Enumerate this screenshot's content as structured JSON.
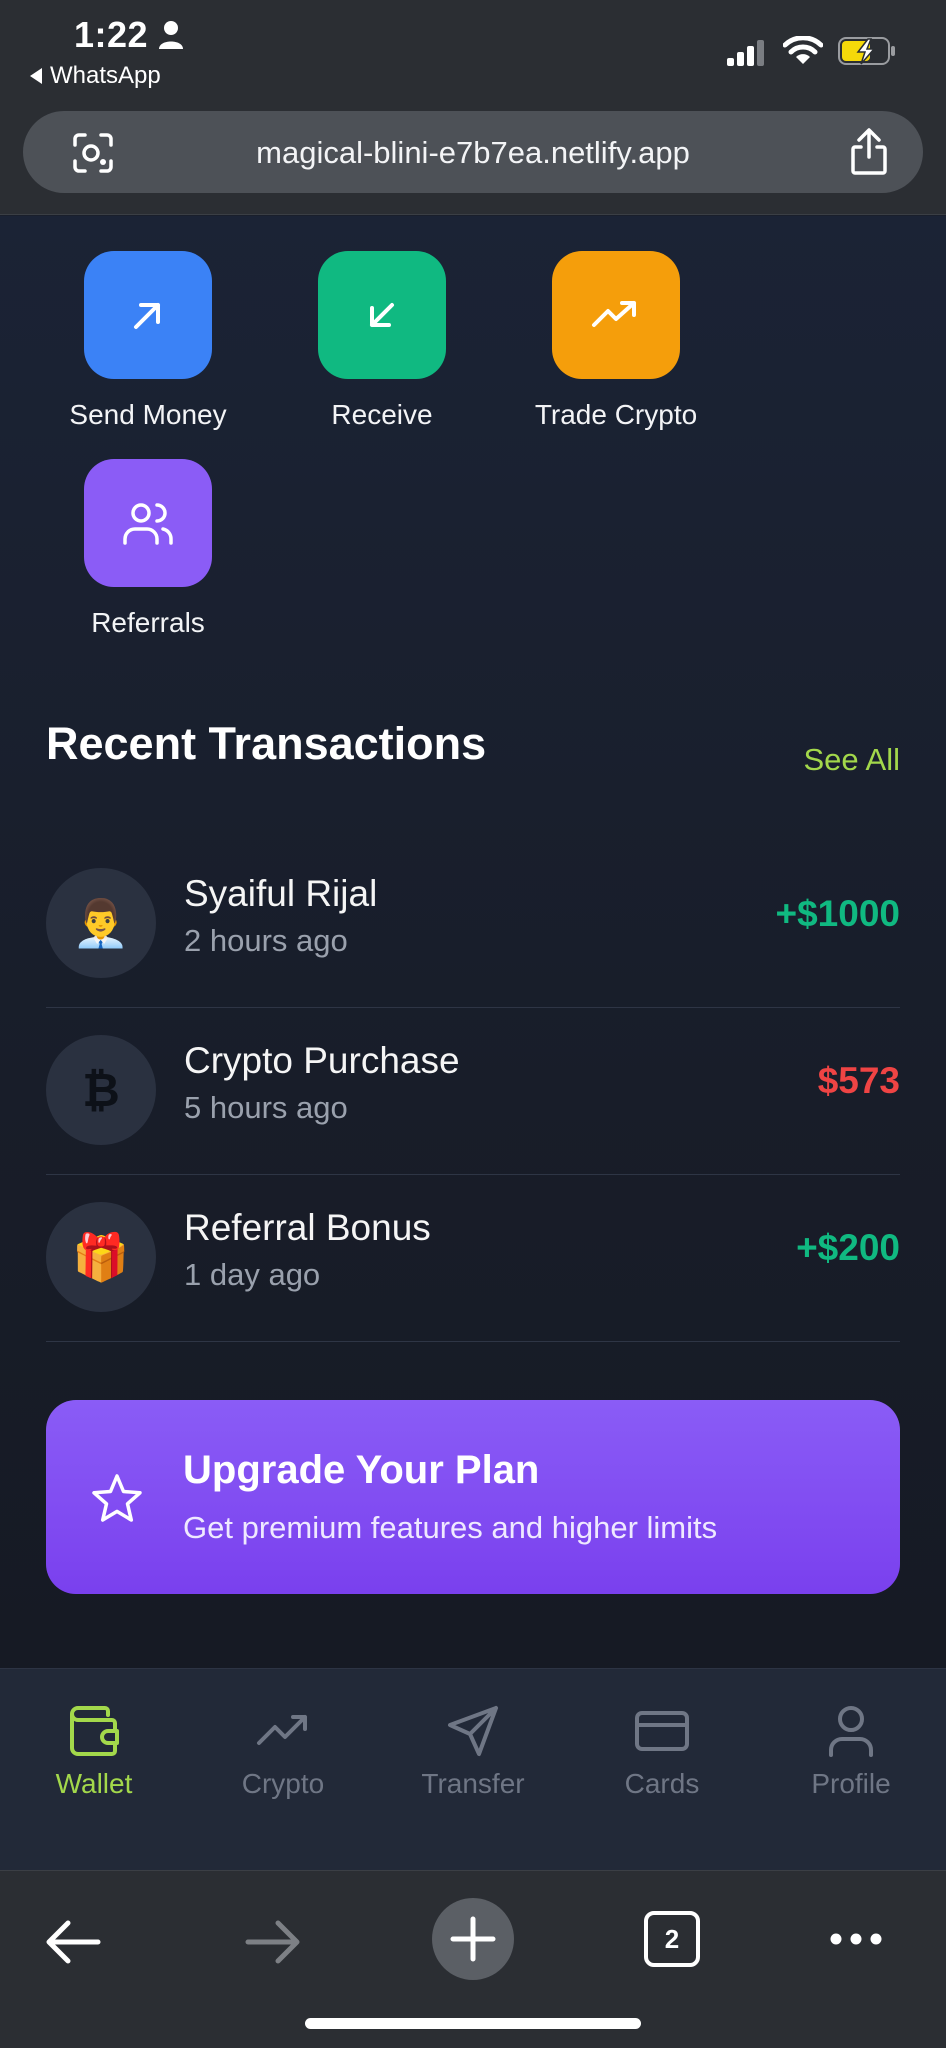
{
  "status_bar": {
    "time": "1:22",
    "back_app": "WhatsApp"
  },
  "browser": {
    "url": "magical-blini-e7b7ea.netlify.app",
    "tab_count": "2"
  },
  "quick_actions": [
    {
      "label": "Send Money",
      "icon": "arrow-up-right-icon",
      "color": "#3b82f6"
    },
    {
      "label": "Receive",
      "icon": "arrow-down-left-icon",
      "color": "#10b981"
    },
    {
      "label": "Trade Crypto",
      "icon": "trending-up-icon",
      "color": "#f59e0b"
    },
    {
      "label": "Referrals",
      "icon": "users-icon",
      "color": "#8b5cf6"
    }
  ],
  "transactions_section": {
    "title": "Recent Transactions",
    "see_all": "See All"
  },
  "transactions": [
    {
      "name": "Syaiful Rijal",
      "time": "2 hours ago",
      "amount": "+$1000",
      "avatar": "👨‍💼",
      "color": "#10b981"
    },
    {
      "name": "Crypto Purchase",
      "time": "5 hours ago",
      "amount": "$573",
      "avatar": "₿",
      "color": "#ef4444"
    },
    {
      "name": "Referral Bonus",
      "time": "1 day ago",
      "amount": "+$200",
      "avatar": "🎁",
      "color": "#10b981"
    }
  ],
  "upgrade": {
    "title": "Upgrade Your Plan",
    "subtitle": "Get premium features and higher limits"
  },
  "bottom_nav": [
    {
      "label": "Wallet",
      "icon": "wallet-icon",
      "active": true
    },
    {
      "label": "Crypto",
      "icon": "trending-up-icon",
      "active": false
    },
    {
      "label": "Transfer",
      "icon": "send-icon",
      "active": false
    },
    {
      "label": "Cards",
      "icon": "credit-card-icon",
      "active": false
    },
    {
      "label": "Profile",
      "icon": "user-icon",
      "active": false
    }
  ],
  "colors": {
    "accent": "#a3d84b",
    "positive": "#10b981",
    "negative": "#ef4444"
  }
}
